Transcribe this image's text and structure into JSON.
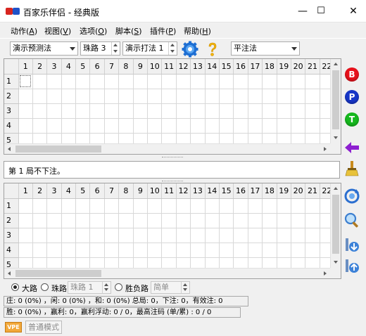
{
  "window": {
    "icon_text": "28",
    "title": "百家乐伴侣 - 经典版",
    "minimize": "—",
    "maximize": "☐",
    "close": "✕"
  },
  "menu": [
    {
      "label": "动作",
      "key": "A"
    },
    {
      "label": "视图",
      "key": "V"
    },
    {
      "label": "选项",
      "key": "O"
    },
    {
      "label": "脚本",
      "key": "S"
    },
    {
      "label": "插件",
      "key": "P"
    },
    {
      "label": "帮助",
      "key": "H"
    }
  ],
  "toolbar": {
    "demo_predict": "演示预测法",
    "bead_road": "珠路 3",
    "demo_play": "演示打法 1",
    "flat_bet": "平注法"
  },
  "top_grid": {
    "columns": [
      "1",
      "2",
      "3",
      "4",
      "5",
      "6",
      "7",
      "8",
      "9",
      "10",
      "11",
      "12",
      "13",
      "14",
      "15",
      "16",
      "17",
      "18",
      "19",
      "20",
      "21",
      "22"
    ],
    "rows": [
      "1",
      "2",
      "3",
      "4",
      "5"
    ]
  },
  "message": "第 1 局不下注。",
  "bottom_grid": {
    "columns": [
      "1",
      "2",
      "3",
      "4",
      "5",
      "6",
      "7",
      "8",
      "9",
      "10",
      "11",
      "12",
      "13",
      "14",
      "15",
      "16",
      "17",
      "18",
      "19",
      "20",
      "21",
      "22"
    ],
    "rows": [
      "1",
      "2",
      "3",
      "4",
      "5"
    ]
  },
  "side_buttons": {
    "banker": "B",
    "player": "P",
    "tie": "T"
  },
  "options": {
    "big_road": "大路",
    "bead_road": "珠路",
    "bead_select": "珠路 1",
    "win_loss_road": "胜负路",
    "simple_select": "简单"
  },
  "status": {
    "line1": "庄: 0 (0%) ，闲: 0 (0%) ，和: 0 (0%)  总局: 0，下注: 0，有效注: 0",
    "line2": "胜: 0 (0%) ，赢利: 0，赢利浮动: 0 / 0，最高注码 (单/累) : 0 / 0"
  },
  "footer": {
    "vpe": "VPE",
    "mode": "普通模式"
  },
  "colors": {
    "banker": "#e8111b",
    "player": "#1736c8",
    "tie": "#16b81e",
    "back_arrow": "#8d1fd0"
  }
}
